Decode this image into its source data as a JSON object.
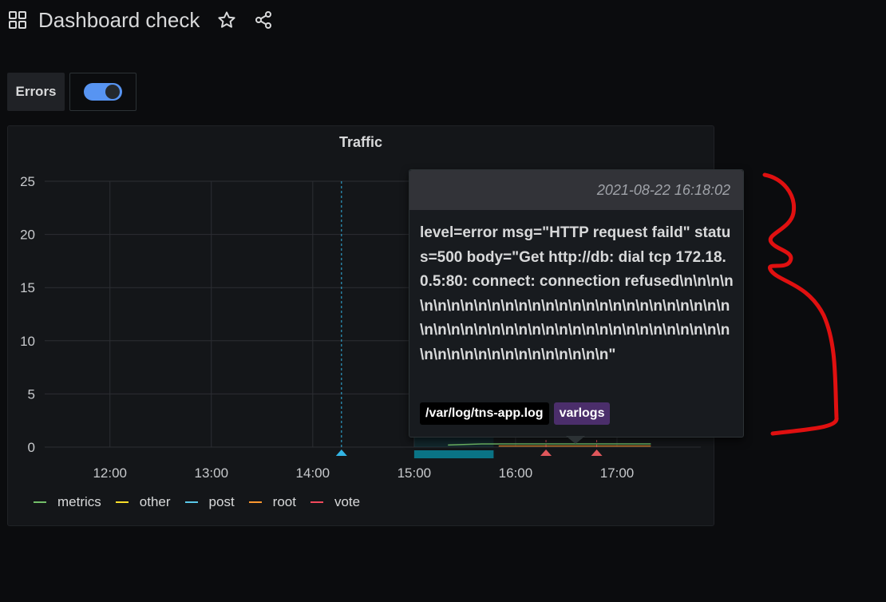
{
  "header": {
    "title": "Dashboard check",
    "icons": [
      "apps-icon",
      "star-icon",
      "share-icon"
    ]
  },
  "variable": {
    "label": "Errors",
    "toggle_on": true
  },
  "panel": {
    "title": "Traffic",
    "legend": [
      {
        "name": "metrics",
        "color": "#73bf69"
      },
      {
        "name": "other",
        "color": "#fade2a"
      },
      {
        "name": "post",
        "color": "#5ac8e8"
      },
      {
        "name": "root",
        "color": "#ff9830"
      },
      {
        "name": "vote",
        "color": "#f2495c"
      }
    ]
  },
  "chart_data": {
    "type": "line",
    "title": "Traffic",
    "y_ticks": [
      "0",
      "5",
      "10",
      "15",
      "20",
      "25"
    ],
    "ylim": [
      0,
      25
    ],
    "x_ticks": [
      "12:00",
      "13:00",
      "14:00",
      "15:00",
      "16:00",
      "17:00"
    ],
    "grid": true,
    "legend_placement": "bottom",
    "annotation_markers": [
      {
        "time": "14:17",
        "color": "#33b5e5"
      },
      {
        "time": "16:18",
        "color": "#e0575b"
      },
      {
        "time": "16:48",
        "color": "#e0575b"
      }
    ],
    "region": {
      "start": "15:00",
      "end": "15:47",
      "color": "#0a7385"
    }
  },
  "tooltip": {
    "timestamp": "2021-08-22 16:18:02",
    "message": "level=error msg=\"HTTP request faild\" status=500 body=\"Get http://db: dial tcp 172.18.0.5:80: connect: connection refused\\n\\n\\n\\n\\n\\n\\n\\n\\n\\n\\n\\n\\n\\n\\n\\n\\n\\n\\n\\n\\n\\n\\n\\n\\n\\n\\n\\n\\n\\n\\n\\n\\n\\n\\n\\n\\n\\n\\n\\n\\n\\n\\n\\n\\n\\n\\n\\n\\n\\n\\n\\n\\n\\n\\n\\n\\n\\n\\n\\n\\n\\n\\n\\n\"",
    "tags": [
      {
        "label": "/var/log/tns-app.log",
        "color": "#000000"
      },
      {
        "label": "varlogs",
        "color": "#4b2e6b"
      }
    ]
  },
  "colors": {
    "accent": "#5794f2",
    "scribble": "#e01010"
  }
}
